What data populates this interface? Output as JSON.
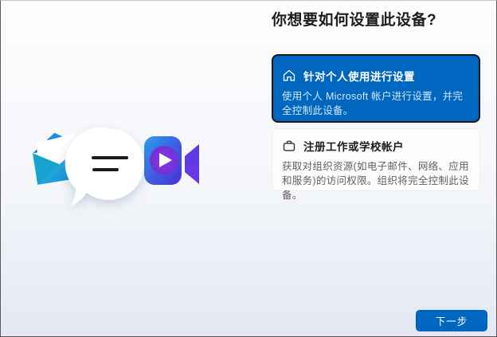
{
  "window": {
    "title": "你想要如何设置此设备?"
  },
  "options": [
    {
      "icon": "home-icon",
      "title": "针对个人使用进行设置",
      "description": "使用个人 Microsoft 帐户进行设置，并完全控制此设备。",
      "selected": true
    },
    {
      "icon": "briefcase-icon",
      "title": "注册工作或学校帐户",
      "description": "获取对组织资源(如电子邮件、网络、应用和服务)的访问权限。组织将完全控制此设备。",
      "selected": false
    }
  ],
  "footer": {
    "next_label": "下一步"
  },
  "illustration": {
    "icons": [
      "mail-icon",
      "chat-bubble-icon",
      "video-camera-icon"
    ]
  },
  "colors": {
    "accent": "#0067c0",
    "selected_card_border": "#161616",
    "background_top": "#fdfdfe",
    "background_bottom": "#e3e8f3"
  }
}
